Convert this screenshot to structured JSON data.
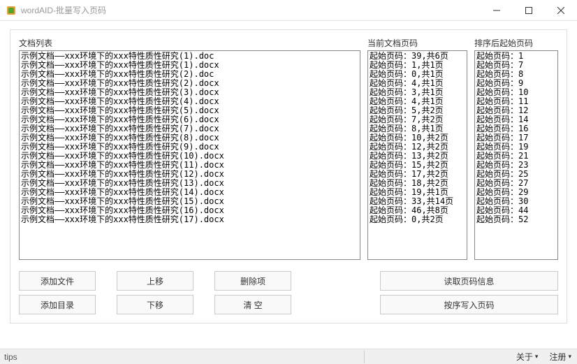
{
  "window": {
    "title": "wordAID-批量写入页码"
  },
  "labels": {
    "doc_list": "文档列表",
    "current_page": "当前文档页码",
    "sorted_page": "排序后起始页码"
  },
  "doc_list": [
    "示例文档――xxx环境下的xxx特性质性研究(1).doc",
    "示例文档――xxx环境下的xxx特性质性研究(1).docx",
    "示例文档――xxx环境下的xxx特性质性研究(2).doc",
    "示例文档――xxx环境下的xxx特性质性研究(2).docx",
    "示例文档――xxx环境下的xxx特性质性研究(3).docx",
    "示例文档――xxx环境下的xxx特性质性研究(4).docx",
    "示例文档――xxx环境下的xxx特性质性研究(5).docx",
    "示例文档――xxx环境下的xxx特性质性研究(6).docx",
    "示例文档――xxx环境下的xxx特性质性研究(7).docx",
    "示例文档――xxx环境下的xxx特性质性研究(8).docx",
    "示例文档――xxx环境下的xxx特性质性研究(9).docx",
    "示例文档――xxx环境下的xxx特性质性研究(10).docx",
    "示例文档――xxx环境下的xxx特性质性研究(11).docx",
    "示例文档――xxx环境下的xxx特性质性研究(12).docx",
    "示例文档――xxx环境下的xxx特性质性研究(13).docx",
    "示例文档――xxx环境下的xxx特性质性研究(14).docx",
    "示例文档――xxx环境下的xxx特性质性研究(15).docx",
    "示例文档――xxx环境下的xxx特性质性研究(16).docx",
    "示例文档――xxx环境下的xxx特性质性研究(17).docx"
  ],
  "current_pages": [
    "起始页码：39,共6页",
    "起始页码：1,共1页",
    "起始页码：0,共1页",
    "起始页码：4,共1页",
    "起始页码：3,共1页",
    "起始页码：4,共1页",
    "起始页码：5,共2页",
    "起始页码：7,共2页",
    "起始页码：8,共1页",
    "起始页码：10,共2页",
    "起始页码：12,共2页",
    "起始页码：13,共2页",
    "起始页码：15,共2页",
    "起始页码：17,共2页",
    "起始页码：18,共2页",
    "起始页码：19,共1页",
    "起始页码：33,共14页",
    "起始页码：46,共8页",
    "起始页码：0,共2页"
  ],
  "sorted_pages": [
    "起始页码：1",
    "起始页码：7",
    "起始页码：8",
    "起始页码：9",
    "起始页码：10",
    "起始页码：11",
    "起始页码：12",
    "起始页码：14",
    "起始页码：16",
    "起始页码：17",
    "起始页码：19",
    "起始页码：21",
    "起始页码：23",
    "起始页码：25",
    "起始页码：27",
    "起始页码：29",
    "起始页码：30",
    "起始页码：44",
    "起始页码：52"
  ],
  "chart_data": [
    {
      "index": 1,
      "ext": "doc",
      "start": 39,
      "pages": 6,
      "sorted_start": 1
    },
    {
      "index": 1,
      "ext": "docx",
      "start": 1,
      "pages": 1,
      "sorted_start": 7
    },
    {
      "index": 2,
      "ext": "doc",
      "start": 0,
      "pages": 1,
      "sorted_start": 8
    },
    {
      "index": 2,
      "ext": "docx",
      "start": 4,
      "pages": 1,
      "sorted_start": 9
    },
    {
      "index": 3,
      "ext": "docx",
      "start": 3,
      "pages": 1,
      "sorted_start": 10
    },
    {
      "index": 4,
      "ext": "docx",
      "start": 4,
      "pages": 1,
      "sorted_start": 11
    },
    {
      "index": 5,
      "ext": "docx",
      "start": 5,
      "pages": 2,
      "sorted_start": 12
    },
    {
      "index": 6,
      "ext": "docx",
      "start": 7,
      "pages": 2,
      "sorted_start": 14
    },
    {
      "index": 7,
      "ext": "docx",
      "start": 8,
      "pages": 1,
      "sorted_start": 16
    },
    {
      "index": 8,
      "ext": "docx",
      "start": 10,
      "pages": 2,
      "sorted_start": 17
    },
    {
      "index": 9,
      "ext": "docx",
      "start": 12,
      "pages": 2,
      "sorted_start": 19
    },
    {
      "index": 10,
      "ext": "docx",
      "start": 13,
      "pages": 2,
      "sorted_start": 21
    },
    {
      "index": 11,
      "ext": "docx",
      "start": 15,
      "pages": 2,
      "sorted_start": 23
    },
    {
      "index": 12,
      "ext": "docx",
      "start": 17,
      "pages": 2,
      "sorted_start": 25
    },
    {
      "index": 13,
      "ext": "docx",
      "start": 18,
      "pages": 2,
      "sorted_start": 27
    },
    {
      "index": 14,
      "ext": "docx",
      "start": 19,
      "pages": 1,
      "sorted_start": 29
    },
    {
      "index": 15,
      "ext": "docx",
      "start": 33,
      "pages": 14,
      "sorted_start": 30
    },
    {
      "index": 16,
      "ext": "docx",
      "start": 46,
      "pages": 8,
      "sorted_start": 44
    },
    {
      "index": 17,
      "ext": "docx",
      "start": 0,
      "pages": 2,
      "sorted_start": 52
    }
  ],
  "buttons": {
    "add_file": "添加文件",
    "add_dir": "添加目录",
    "move_up": "上移",
    "move_down": "下移",
    "delete": "删除项",
    "clear": "清  空",
    "read_info": "读取页码信息",
    "write_seq": "按序写入页码"
  },
  "status": {
    "tips": "tips",
    "about": "关于",
    "register": "注册"
  }
}
